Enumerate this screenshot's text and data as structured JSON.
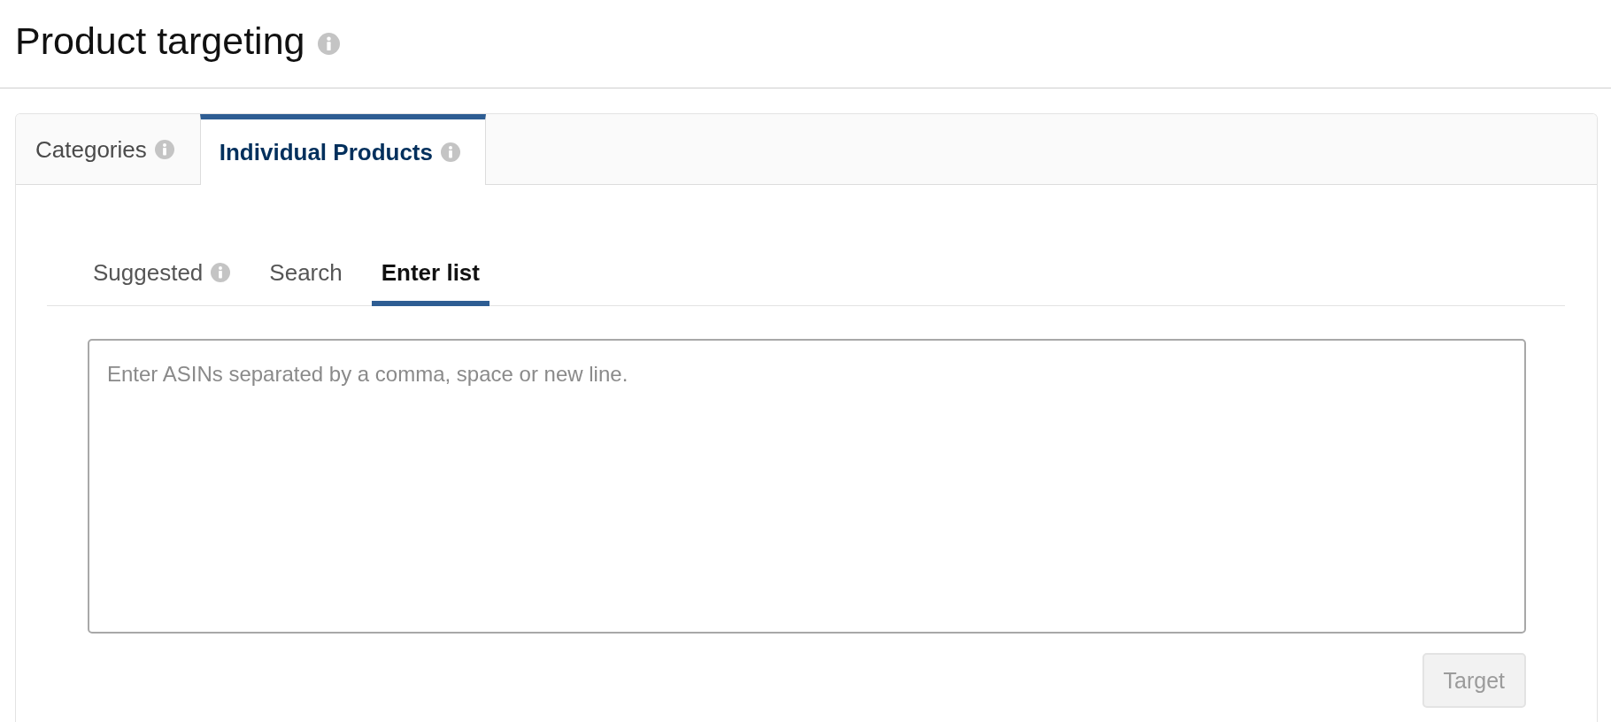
{
  "header": {
    "title": "Product targeting",
    "info": true
  },
  "tabs": [
    {
      "label": "Categories",
      "info": true,
      "selected": false
    },
    {
      "label": "Individual Products",
      "info": true,
      "selected": true
    }
  ],
  "subtabs": [
    {
      "label": "Suggested",
      "info": true,
      "selected": false
    },
    {
      "label": "Search",
      "info": false,
      "selected": false
    },
    {
      "label": "Enter list",
      "info": false,
      "selected": true
    }
  ],
  "asin_input": {
    "placeholder": "Enter ASINs separated by a comma, space or new line."
  },
  "target_button": {
    "label": "Target",
    "disabled": true
  }
}
